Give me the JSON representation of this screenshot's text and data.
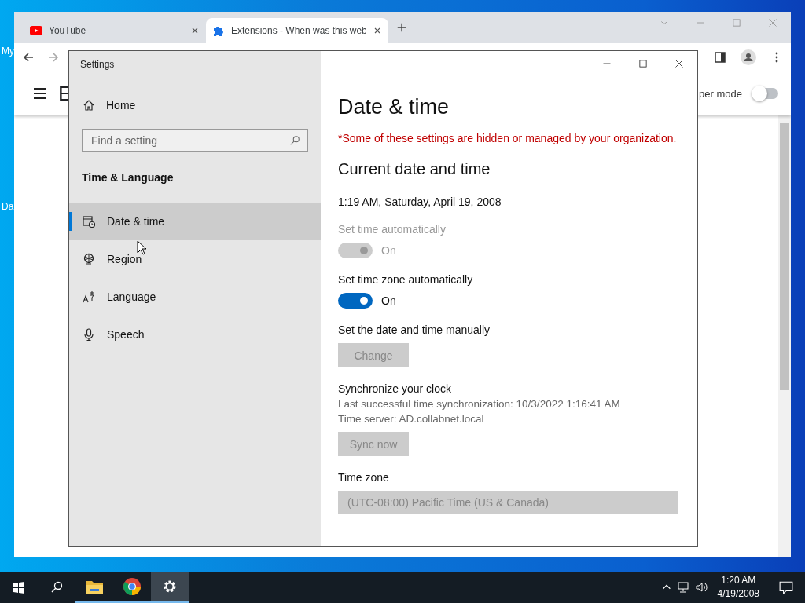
{
  "desktop": {
    "icons": [
      {
        "label": "My"
      },
      {
        "label": "Da"
      }
    ]
  },
  "browser": {
    "tabs": [
      {
        "title": "YouTube",
        "selected": false,
        "kind": "youtube"
      },
      {
        "title": "Extensions - When was this web",
        "selected": true,
        "kind": "extension"
      }
    ],
    "page": {
      "heading": "E",
      "toggle_label": "per mode",
      "toggle_on": false
    }
  },
  "settings": {
    "title": "Settings",
    "home": "Home",
    "search": {
      "placeholder": "Find a setting"
    },
    "section": "Time & Language",
    "nav": [
      {
        "label": "Date & time",
        "selected": true,
        "kind": "calendar"
      },
      {
        "label": "Region",
        "selected": false,
        "kind": "globe"
      },
      {
        "label": "Language",
        "selected": false,
        "kind": "language"
      },
      {
        "label": "Speech",
        "selected": false,
        "kind": "microphone"
      }
    ],
    "content": {
      "title": "Date & time",
      "notice": "*Some of these settings are hidden or managed by your organization.",
      "subtitle": "Current date and time",
      "current": "1:19 AM, Saturday, April 19, 2008",
      "groups": [
        {
          "kind": "toggle",
          "label": "Set time automatically",
          "on": true,
          "disabled": true,
          "state_text": "On"
        },
        {
          "kind": "toggle",
          "label": "Set time zone automatically",
          "on": true,
          "disabled": false,
          "state_text": "On"
        },
        {
          "kind": "button",
          "label": "Set the date and time manually",
          "button": "Change",
          "disabled": true
        },
        {
          "kind": "button",
          "label": "Synchronize your clock",
          "lines": [
            "Last successful time synchronization: 10/3/2022 1:16:41 AM",
            "Time server: AD.collabnet.local"
          ],
          "button": "Sync now",
          "disabled": true
        },
        {
          "kind": "dropdown",
          "label": "Time zone",
          "value": "(UTC-08:00) Pacific Time (US & Canada)",
          "disabled": true
        }
      ]
    }
  },
  "taskbar": {
    "apps": [
      {
        "kind": "explorer",
        "selected": false
      },
      {
        "kind": "chrome",
        "selected": false
      },
      {
        "kind": "settings",
        "selected": true
      }
    ],
    "time": "1:20 AM",
    "date": "4/19/2008"
  }
}
